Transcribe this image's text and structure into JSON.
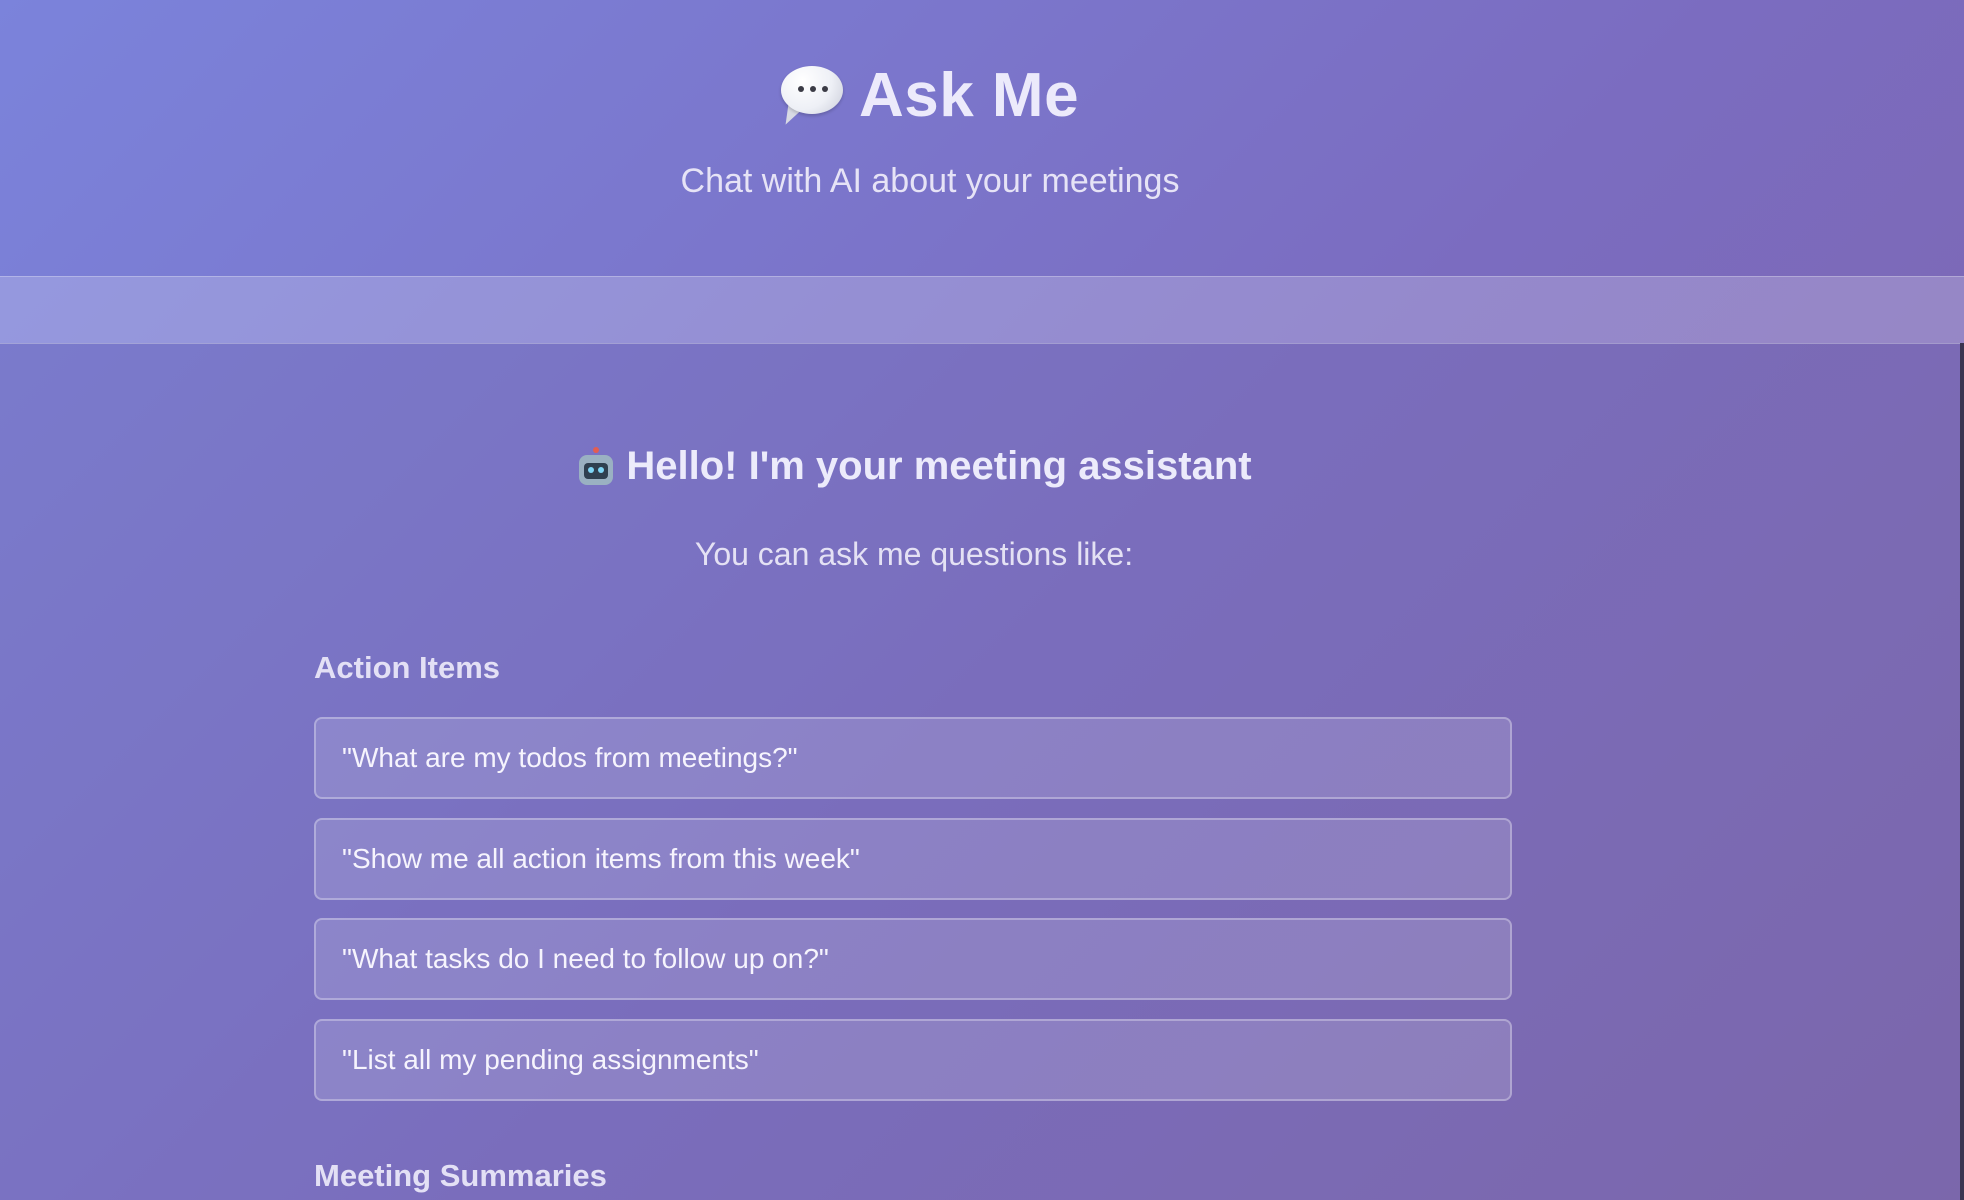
{
  "header": {
    "title": "Ask Me",
    "title_icon": "speech-bubble-icon",
    "subtitle": "Chat with AI about your meetings"
  },
  "welcome": {
    "icon": "robot-icon",
    "heading": "Hello! I'm your meeting assistant",
    "hint": "You can ask me questions like:"
  },
  "sections": [
    {
      "heading": "Action Items",
      "suggestions": [
        "\"What are my todos from meetings?\"",
        "\"Show me all action items from this week\"",
        "\"What tasks do I need to follow up on?\"",
        "\"List all my pending assignments\""
      ]
    },
    {
      "heading": "Meeting Summaries",
      "suggestions": []
    }
  ],
  "colors": {
    "gradient_start": "#7b83db",
    "gradient_end": "#7d64aa",
    "text": "#eceaf8"
  }
}
